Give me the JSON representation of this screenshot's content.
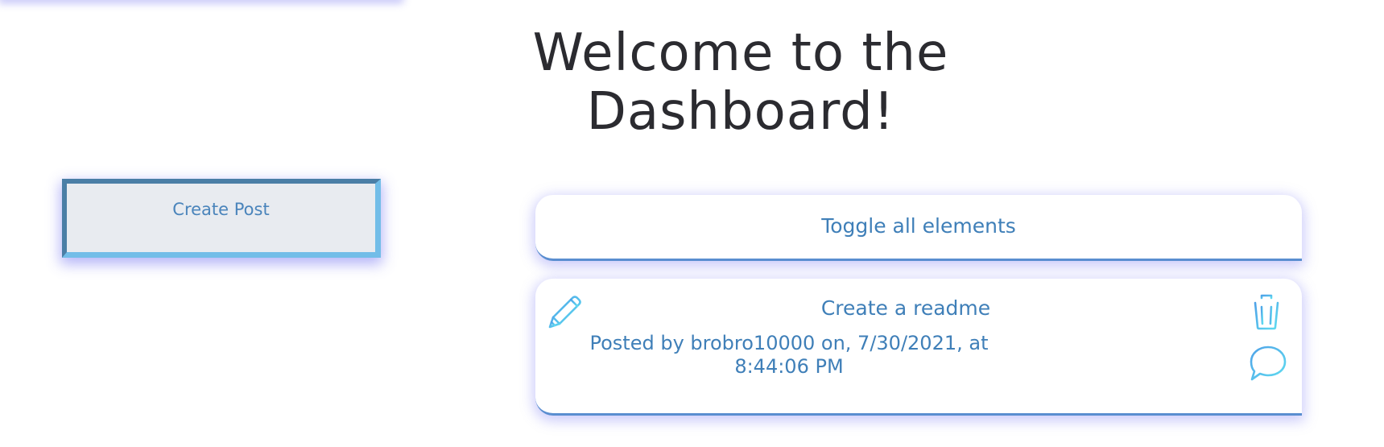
{
  "header": {
    "title": "Welcome to the Dashboard!"
  },
  "sidebar": {
    "create_post_label": "Create Post"
  },
  "main": {
    "toggle_label": "Toggle all elements",
    "posts": [
      {
        "title": "Create a readme",
        "meta": "Posted by brobro10000 on, 7/30/2021, at 8:44:06 PM",
        "icons": {
          "edit": "pencil-icon",
          "delete": "trash-icon",
          "comment": "comment-bubble-icon"
        }
      }
    ]
  },
  "colors": {
    "text_accent": "#3f7fb8",
    "icon_gradient_start": "#4fa2e8",
    "icon_gradient_end": "#5fdcf0",
    "button_bg": "#e8ebf0",
    "title_text": "#2b2b30"
  }
}
